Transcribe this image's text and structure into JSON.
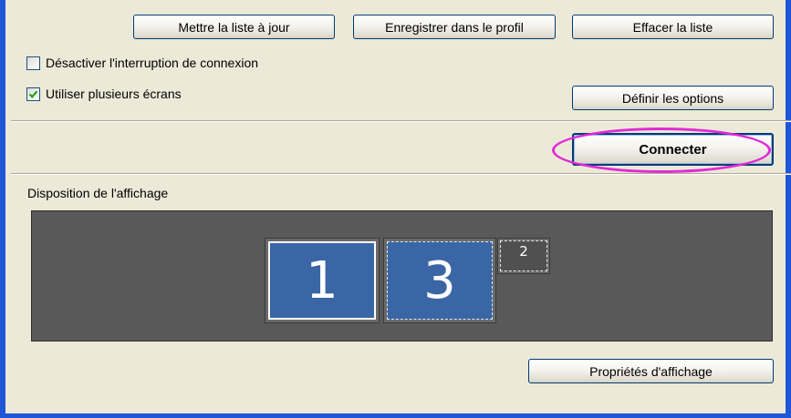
{
  "toolbar": {
    "update_list": "Mettre la liste à jour",
    "save_profile": "Enregistrer dans le profil",
    "clear_list": "Effacer la liste"
  },
  "options": {
    "disable_interrupt": {
      "label": "Désactiver l'interruption de connexion",
      "checked": false
    },
    "multi_screens": {
      "label": "Utiliser plusieurs écrans",
      "checked": true
    },
    "define_options": "Définir les options"
  },
  "connect": {
    "label": "Connecter"
  },
  "display": {
    "section_title": "Disposition de l'affichage",
    "monitors": [
      {
        "number": "1",
        "state": "primary"
      },
      {
        "number": "3",
        "state": "secondary"
      },
      {
        "number": "2",
        "state": "inactive"
      }
    ],
    "properties_button": "Propriétés d'affichage"
  },
  "colors": {
    "window_border": "#1f56d6",
    "dialog_bg": "#ece9d8",
    "monitor_blue": "#3a66a6",
    "layout_bg": "#595959",
    "highlight": "#e02ad6"
  }
}
